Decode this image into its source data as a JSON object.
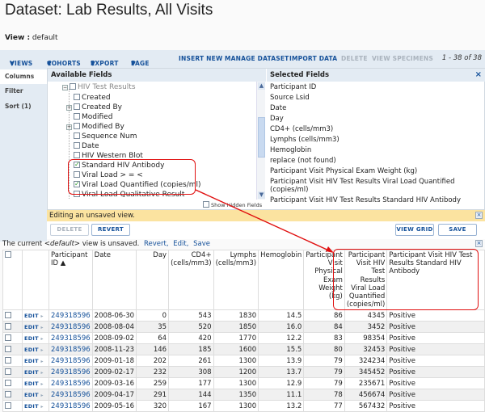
{
  "page": {
    "title": "Dataset: Lab Results, All Visits",
    "view_label": "View :",
    "view_value": "default"
  },
  "toolbar": {
    "items": [
      {
        "label": "VIEWS",
        "has_menu": true,
        "enabled": true
      },
      {
        "label": "COHORTS",
        "has_menu": true,
        "enabled": true
      },
      {
        "label": "EXPORT",
        "has_menu": true,
        "enabled": true
      },
      {
        "label": "PAGE SIZE",
        "has_menu": true,
        "enabled": true
      },
      {
        "label": "INSERT NEW",
        "has_menu": false,
        "enabled": true
      },
      {
        "label": "MANAGE DATASET",
        "has_menu": false,
        "enabled": true
      },
      {
        "label": "IMPORT DATA",
        "has_menu": false,
        "enabled": true
      },
      {
        "label": "DELETE",
        "has_menu": false,
        "enabled": false
      },
      {
        "label": "VIEW SPECIMENS",
        "has_menu": false,
        "enabled": false
      }
    ],
    "pager": "1 - 38 of 38",
    "menu_arrow": "▼"
  },
  "side_tabs": [
    {
      "label": "Columns",
      "active": true
    },
    {
      "label": "Filter",
      "active": false
    },
    {
      "label": "Sort (1)",
      "active": false
    }
  ],
  "available_fields": {
    "header": "Available Fields",
    "nodes": [
      {
        "label": "HIV Test Results",
        "checked": false,
        "expander": "minus",
        "disabled": true
      },
      {
        "label": "Created",
        "checked": false,
        "expander": null
      },
      {
        "label": "Created By",
        "checked": false,
        "expander": "plus"
      },
      {
        "label": "Modified",
        "checked": false,
        "expander": null
      },
      {
        "label": "Modified By",
        "checked": false,
        "expander": "plus"
      },
      {
        "label": "Sequence Num",
        "checked": false,
        "expander": null
      },
      {
        "label": "Date",
        "checked": false,
        "expander": null
      },
      {
        "label": "HIV Western Blot",
        "checked": false,
        "expander": null
      },
      {
        "label": "Standard HIV Antibody",
        "checked": true,
        "expander": null
      },
      {
        "label": "Viral Load > = <",
        "checked": false,
        "expander": null
      },
      {
        "label": "Viral Load Quantified (copies/ml)",
        "checked": true,
        "expander": null
      },
      {
        "label": "Viral Load Qualitative Result",
        "checked": false,
        "expander": null
      }
    ],
    "show_hidden_label": "Show Hidden Fields",
    "show_hidden_checked": false
  },
  "selected_fields": {
    "header": "Selected Fields",
    "close_icon": "×",
    "items": [
      "Participant ID",
      "Source Lsid",
      "Date",
      "Day",
      "CD4+ (cells/mm3)",
      "Lymphs (cells/mm3)",
      "Hemoglobin",
      "replace (not found)",
      "Participant Visit Physical Exam Weight (kg)",
      "Participant Visit HIV Test Results Viral Load Quantified (copies/ml)",
      "Participant Visit HIV Test Results Standard HIV Antibody"
    ]
  },
  "editing_bar": {
    "message": "Editing an unsaved view.",
    "close_icon": "×",
    "buttons": {
      "delete": "DELETE",
      "revert": "REVERT",
      "view_grid": "VIEW GRID",
      "save": "SAVE"
    }
  },
  "unsaved_notice": {
    "prefix": "The current",
    "view_name": "<default>",
    "suffix": "view is unsaved.",
    "links": [
      "Revert,",
      "Edit,",
      "Save"
    ],
    "close_icon": "×"
  },
  "grid": {
    "columns": [
      {
        "label": "",
        "align": "left"
      },
      {
        "label": "",
        "align": "left"
      },
      {
        "label": "Participant ID ▲",
        "align": "left"
      },
      {
        "label": "Date",
        "align": "left"
      },
      {
        "label": "Day",
        "align": "right"
      },
      {
        "label": "CD4+ (cells/mm3)",
        "align": "right"
      },
      {
        "label": "Lymphs (cells/mm3)",
        "align": "right"
      },
      {
        "label": "Hemoglobin",
        "align": "right"
      },
      {
        "label": "Participant Visit Physical Exam Weight (kg)",
        "align": "right"
      },
      {
        "label": "Participant Visit HIV Test Results Viral Load Quantified (copies/ml)",
        "align": "right"
      },
      {
        "label": "Participant Visit HIV Test Results Standard HIV Antibody",
        "align": "left"
      }
    ],
    "edit_label": "EDIT",
    "edit_arrow": "▸",
    "rows": [
      {
        "pid": "249318596",
        "date": "2008-06-30",
        "day": "0",
        "cd4": "543",
        "lymphs": "1830",
        "hemoglobin": "14.5",
        "weight": "86",
        "viral_load": "4345",
        "antibody": "Positive"
      },
      {
        "pid": "249318596",
        "date": "2008-08-04",
        "day": "35",
        "cd4": "520",
        "lymphs": "1850",
        "hemoglobin": "16.0",
        "weight": "84",
        "viral_load": "3452",
        "antibody": "Positive"
      },
      {
        "pid": "249318596",
        "date": "2008-09-02",
        "day": "64",
        "cd4": "420",
        "lymphs": "1770",
        "hemoglobin": "12.2",
        "weight": "83",
        "viral_load": "98354",
        "antibody": "Positive"
      },
      {
        "pid": "249318596",
        "date": "2008-11-23",
        "day": "146",
        "cd4": "185",
        "lymphs": "1600",
        "hemoglobin": "15.5",
        "weight": "80",
        "viral_load": "32453",
        "antibody": "Positive"
      },
      {
        "pid": "249318596",
        "date": "2009-01-18",
        "day": "202",
        "cd4": "261",
        "lymphs": "1300",
        "hemoglobin": "13.9",
        "weight": "79",
        "viral_load": "324234",
        "antibody": "Positive"
      },
      {
        "pid": "249318596",
        "date": "2009-02-17",
        "day": "232",
        "cd4": "308",
        "lymphs": "1200",
        "hemoglobin": "13.7",
        "weight": "79",
        "viral_load": "345452",
        "antibody": "Positive"
      },
      {
        "pid": "249318596",
        "date": "2009-03-16",
        "day": "259",
        "cd4": "177",
        "lymphs": "1300",
        "hemoglobin": "12.9",
        "weight": "79",
        "viral_load": "235671",
        "antibody": "Positive"
      },
      {
        "pid": "249318596",
        "date": "2009-04-17",
        "day": "291",
        "cd4": "144",
        "lymphs": "1350",
        "hemoglobin": "11.1",
        "weight": "78",
        "viral_load": "456674",
        "antibody": "Positive"
      },
      {
        "pid": "249318596",
        "date": "2009-05-16",
        "day": "320",
        "cd4": "167",
        "lymphs": "1300",
        "hemoglobin": "13.2",
        "weight": "77",
        "viral_load": "567432",
        "antibody": "Positive"
      }
    ]
  },
  "colors": {
    "link": "#15519a",
    "toolbar_bg": "#e3ebf3",
    "editing_bar_bg": "#fbe3a0",
    "annotation_red": "#e01010",
    "checkmark_green": "#2a9a2a"
  }
}
